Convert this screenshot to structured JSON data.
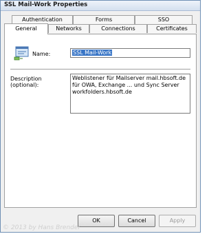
{
  "window": {
    "title": "SSL Mail-Work  Properties"
  },
  "tabs": {
    "row1": [
      "Authentication",
      "Forms",
      "SSO"
    ],
    "row2": [
      "General",
      "Networks",
      "Connections",
      "Certificates"
    ],
    "active": "General"
  },
  "general": {
    "icon": "network-rule-icon",
    "name_label": "Name:",
    "name_value": "SSL Mail-Work",
    "description_label_line1": "Description",
    "description_label_line2": "(optional):",
    "description_value": "Weblistener für Mailserver  mail.hbsoft.de\nfür OWA, Exchange ... und Sync Server\nworkfolders.hbsoft.de"
  },
  "buttons": {
    "ok": "OK",
    "cancel": "Cancel",
    "apply": "Apply"
  },
  "watermark": "© 2013 by Hans Brender"
}
